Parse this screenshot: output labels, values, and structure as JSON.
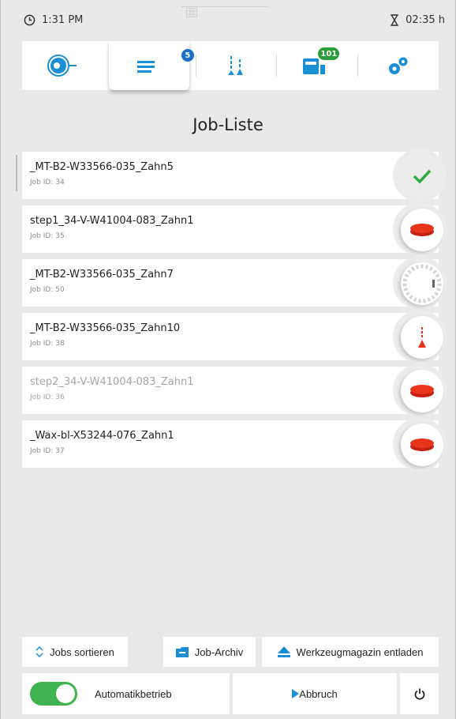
{
  "status": {
    "time": "1:31 PM",
    "duration": "02:35 h"
  },
  "nav": {
    "tabs": [
      {
        "name": "machine",
        "icon": "spindle-icon"
      },
      {
        "name": "job-list",
        "icon": "list-icon",
        "badge": "5",
        "badge_color": "#1a6fc9"
      },
      {
        "name": "tools",
        "icon": "tools-icon"
      },
      {
        "name": "magazine",
        "icon": "magazine-icon",
        "badge": "101",
        "badge_color": "#2a9c3a"
      },
      {
        "name": "settings",
        "icon": "gears-icon"
      }
    ]
  },
  "page_title": "Job-Liste",
  "jobs": [
    {
      "name": "_MT-B2-W33566-035_Zahn5",
      "id": "Job ID: 34",
      "status": "done-check-icon"
    },
    {
      "name": "step1_34-V-W41004-083_Zahn1",
      "id": "Job ID: 35",
      "status": "blank-disc-icon"
    },
    {
      "name": "_MT-B2-W33566-035_Zahn7",
      "id": "Job ID: 50",
      "status": "magazine-loading-icon"
    },
    {
      "name": "_MT-B2-W33566-035_Zahn10",
      "id": "Job ID: 38",
      "status": "tool-icon"
    },
    {
      "name": "step2_34-V-W41004-083_Zahn1",
      "id": "Job ID: 36",
      "status": "blank-disc-icon"
    },
    {
      "name": "_Wax-bl-X53244-076_Zahn1",
      "id": "Job ID: 37",
      "status": "blank-disc-icon"
    }
  ],
  "actions": {
    "sort": "Jobs sortieren",
    "archive": "Job-Archiv",
    "unload": "Werkzeugmagazin entladen"
  },
  "footer": {
    "auto_mode": "Automatikbetrieb",
    "abort": "Abbruch"
  },
  "colors": {
    "accent_blue": "#1a8fd6",
    "green": "#3fb34f",
    "red": "#e8341c"
  }
}
